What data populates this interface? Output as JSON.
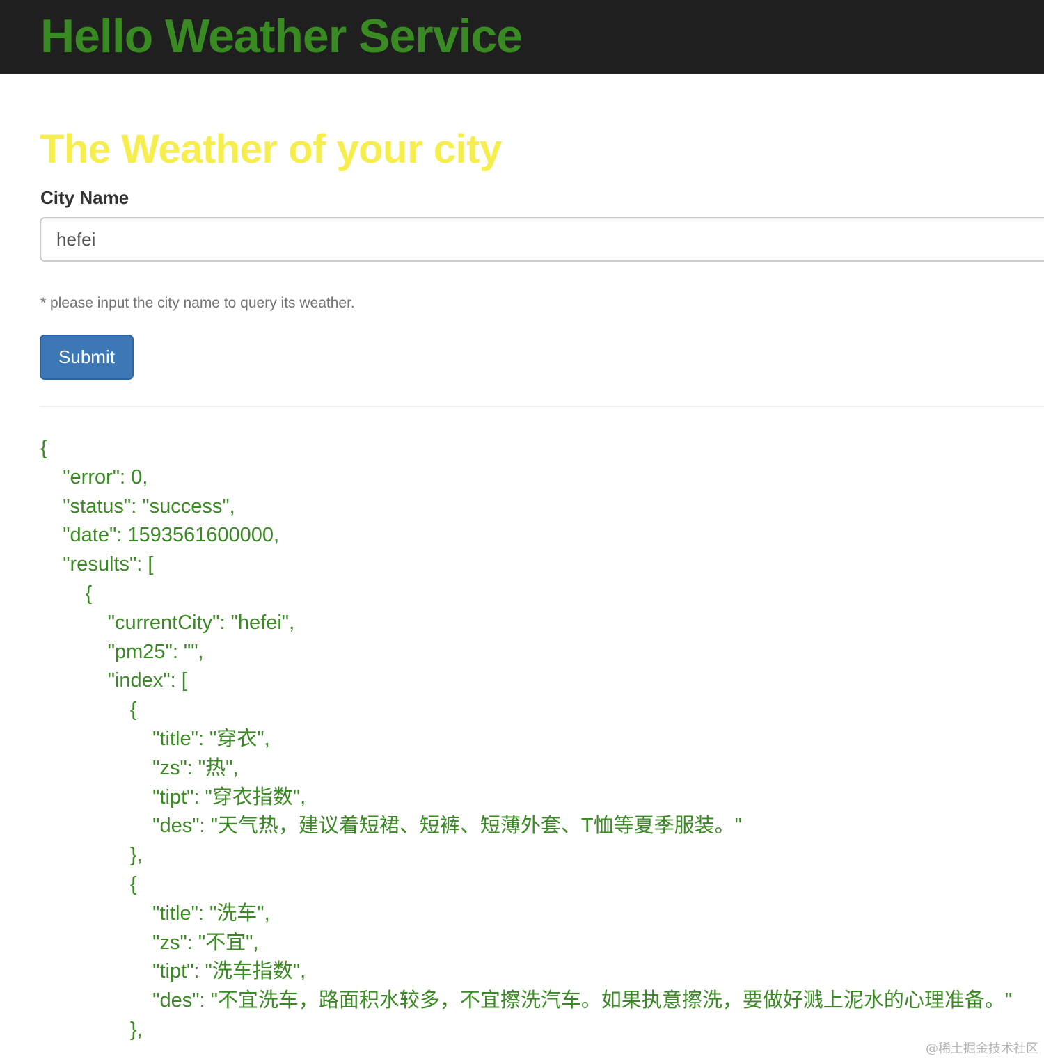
{
  "navbar": {
    "brand": "Hello Weather Service"
  },
  "form": {
    "heading": "The Weather of your city",
    "city_label": "City Name",
    "city_value": "hefei",
    "help_text": "* please input the city name to query its weather.",
    "submit_label": "Submit"
  },
  "result": {
    "json_text": "{\n    \"error\": 0,\n    \"status\": \"success\",\n    \"date\": 1593561600000,\n    \"results\": [\n        {\n            \"currentCity\": \"hefei\",\n            \"pm25\": \"\",\n            \"index\": [\n                {\n                    \"title\": \"穿衣\",\n                    \"zs\": \"热\",\n                    \"tipt\": \"穿衣指数\",\n                    \"des\": \"天气热，建议着短裙、短裤、短薄外套、T恤等夏季服装。\"\n                },\n                {\n                    \"title\": \"洗车\",\n                    \"zs\": \"不宜\",\n                    \"tipt\": \"洗车指数\",\n                    \"des\": \"不宜洗车，路面积水较多，不宜擦洗汽车。如果执意擦洗，要做好溅上泥水的心理准备。\"\n                },"
  },
  "watermark": "@稀土掘金技术社区",
  "colors": {
    "navbar_bg": "#1f1f1f",
    "brand": "#3a8a23",
    "heading": "#f5ee4c",
    "json_text": "#3a8a23",
    "button_bg": "#3d78b6"
  }
}
